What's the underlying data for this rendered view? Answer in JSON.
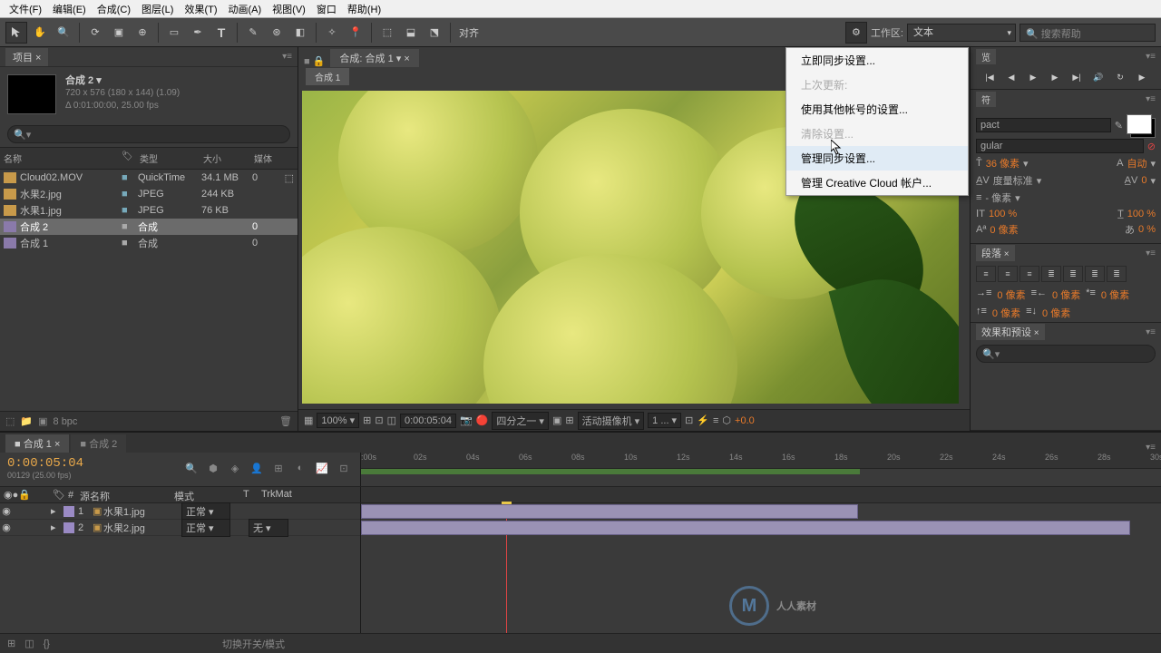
{
  "menubar": [
    "文件(F)",
    "编辑(E)",
    "合成(C)",
    "图层(L)",
    "效果(T)",
    "动画(A)",
    "视图(V)",
    "窗口",
    "帮助(H)"
  ],
  "toolbar": {
    "align_label": "对齐",
    "workspace_label": "工作区:",
    "workspace_value": "文本",
    "search_help_placeholder": "搜索帮助"
  },
  "project_panel": {
    "title": "项目",
    "comp": {
      "name": "合成 2",
      "dims": "720 x 576  (180 x 144) (1.09)",
      "duration": "Δ 0:01:00:00, 25.00 fps"
    },
    "columns": {
      "name": "名称",
      "type": "类型",
      "size": "大小",
      "media": "媒体"
    },
    "items": [
      {
        "name": "Cloud02.MOV",
        "type": "QuickTime",
        "size": "34.1 MB",
        "mark": "0"
      },
      {
        "name": "水果2.jpg",
        "type": "JPEG",
        "size": "244 KB",
        "mark": ""
      },
      {
        "name": "水果1.jpg",
        "type": "JPEG",
        "size": "76 KB",
        "mark": ""
      },
      {
        "name": "合成 2",
        "type": "合成",
        "size": "",
        "mark": "0"
      },
      {
        "name": "合成 1",
        "type": "合成",
        "size": "",
        "mark": "0"
      }
    ],
    "bpc": "8 bpc"
  },
  "composition": {
    "tab_prefix": "合成:",
    "tab_name": "合成 1",
    "subtab": "合成 1"
  },
  "viewer_controls": {
    "zoom": "100%",
    "timecode": "0:00:05:04",
    "resolution": "四分之一",
    "camera": "活动摄像机",
    "views": "1 ...",
    "exposure": "+0.0"
  },
  "right_panels": {
    "preview_tab": "览",
    "char_tab": "符",
    "font": "pact",
    "style": "gular",
    "size_label": "36 像素",
    "auto": "自动",
    "tracking": "度量标准",
    "spacing": "- 像素",
    "vscale": "100 %",
    "hscale": "100 %",
    "baseline": "0 像素",
    "tsume": "0 %",
    "para_tab": "段落",
    "para_vals": {
      "left": "0 像素",
      "right": "0 像素",
      "first": "0 像素",
      "before": "0 像素",
      "after": "0 像素"
    },
    "effects_tab": "效果和预设"
  },
  "sync_menu": {
    "items": [
      {
        "label": "立即同步设置...",
        "enabled": true
      },
      {
        "label": "上次更新:",
        "enabled": false
      },
      {
        "label": "使用其他帐号的设置...",
        "enabled": true
      },
      {
        "label": "清除设置...",
        "enabled": false
      },
      {
        "label": "管理同步设置...",
        "enabled": true,
        "hover": true
      },
      {
        "label": "管理 Creative Cloud 帐户...",
        "enabled": true
      }
    ]
  },
  "timeline": {
    "tabs": [
      {
        "name": "合成 1",
        "active": true
      },
      {
        "name": "合成 2",
        "active": false
      }
    ],
    "timecode": "0:00:05:04",
    "frame_info": "00129 (25.00 fps)",
    "col_source": "源名称",
    "col_mode": "模式",
    "col_trkmat": "TrkMat",
    "ruler_ticks": [
      ":00s",
      "02s",
      "04s",
      "06s",
      "08s",
      "10s",
      "12s",
      "14s",
      "16s",
      "18s",
      "20s",
      "22s",
      "24s",
      "26s",
      "28s",
      "30s"
    ],
    "layers": [
      {
        "num": "1",
        "name": "水果1.jpg",
        "mode": "正常",
        "trkmat": ""
      },
      {
        "num": "2",
        "name": "水果2.jpg",
        "mode": "正常",
        "trkmat": "无"
      }
    ]
  },
  "footer": {
    "toggle": "切换开关/模式"
  },
  "watermark": "人人素材"
}
